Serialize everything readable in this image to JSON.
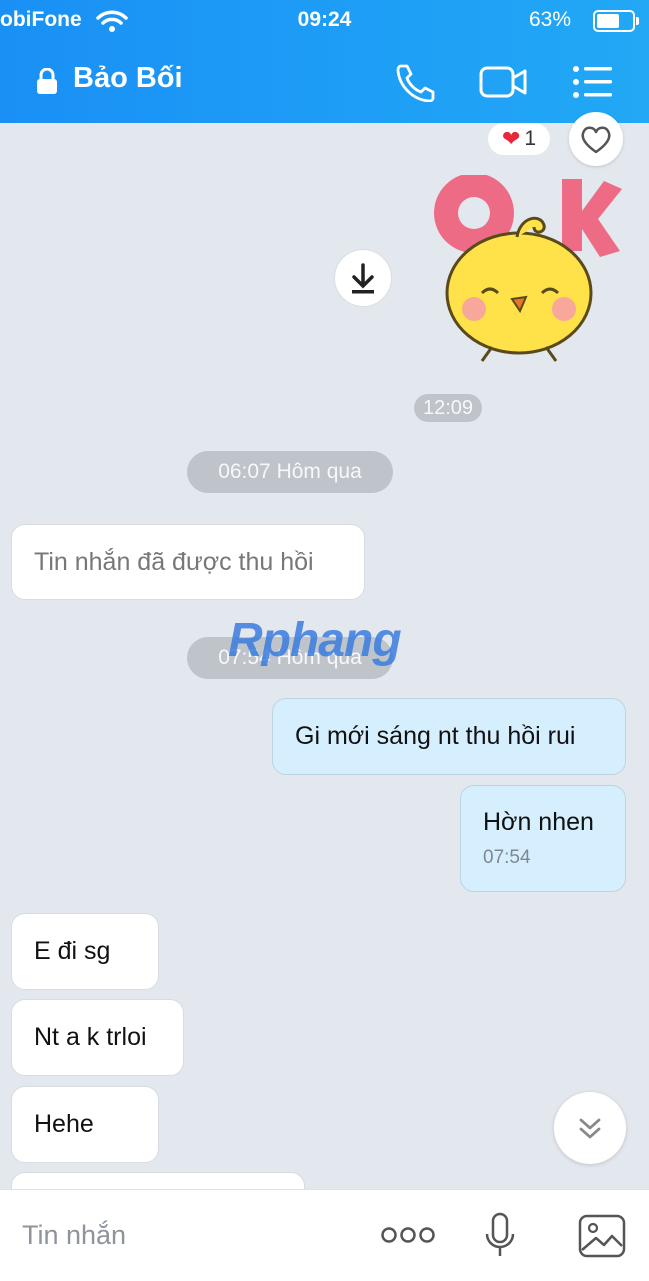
{
  "status_bar": {
    "carrier": "obiFone",
    "time": "09:24",
    "battery": "63%"
  },
  "header": {
    "title": "Bảo Bối"
  },
  "reaction": {
    "emoji": "❤",
    "count": "1"
  },
  "sticker": {
    "text": "OK",
    "time": "12:09"
  },
  "messages": [
    {
      "type": "date",
      "text": "06:07 Hôm qua"
    },
    {
      "type": "in",
      "text": "Tin nhắn đã được thu hồi"
    },
    {
      "type": "date",
      "text": "07:54 Hôm qua"
    },
    {
      "type": "out",
      "text": "Gi mới sáng nt thu hồi rui"
    },
    {
      "type": "out",
      "text": "Hờn nhen",
      "time": "07:54"
    },
    {
      "type": "in",
      "text": "E đi sg"
    },
    {
      "type": "in",
      "text": "Nt a k trloi"
    },
    {
      "type": "in",
      "text": "Hehe"
    }
  ],
  "watermark": "Rphang",
  "composer": {
    "placeholder": "Tin nhắn"
  },
  "colors": {
    "header": "#1e9ff6",
    "outgoing_bubble": "#d6efff",
    "background": "#e3e7ee"
  }
}
